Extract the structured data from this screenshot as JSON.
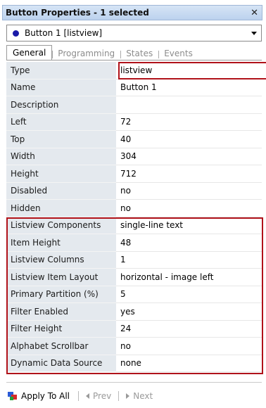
{
  "window": {
    "title": "Button Properties - 1 selected",
    "close_glyph": "✕"
  },
  "selector": {
    "value": "Button 1  [listview]",
    "dot_color": "#1a1aa8"
  },
  "tabs": [
    {
      "label": "General",
      "active": true
    },
    {
      "label": "Programming",
      "active": false
    },
    {
      "label": "States",
      "active": false
    },
    {
      "label": "Events",
      "active": false
    }
  ],
  "properties": [
    {
      "key": "Type",
      "value": "listview"
    },
    {
      "key": "Name",
      "value": "Button 1"
    },
    {
      "key": "Description",
      "value": ""
    },
    {
      "key": "Left",
      "value": "72"
    },
    {
      "key": "Top",
      "value": "40"
    },
    {
      "key": "Width",
      "value": "304"
    },
    {
      "key": "Height",
      "value": "712"
    },
    {
      "key": "Disabled",
      "value": "no"
    },
    {
      "key": "Hidden",
      "value": "no"
    },
    {
      "key": "Listview Components",
      "value": "single-line text"
    },
    {
      "key": "Item Height",
      "value": "48"
    },
    {
      "key": "Listview Columns",
      "value": "1"
    },
    {
      "key": "Listview Item Layout",
      "value": "horizontal - image left"
    },
    {
      "key": "Primary Partition (%)",
      "value": "5"
    },
    {
      "key": "Filter Enabled",
      "value": "yes"
    },
    {
      "key": "Filter Height",
      "value": "24"
    },
    {
      "key": "Alphabet Scrollbar",
      "value": "no"
    },
    {
      "key": "Dynamic Data Source",
      "value": "none"
    }
  ],
  "footer": {
    "apply_label": "Apply To All",
    "prev_label": "Prev",
    "next_label": "Next"
  },
  "colors": {
    "highlight": "#b0121a",
    "key_bg": "#e4e9ee",
    "title_bg": "#c9dbf2"
  }
}
